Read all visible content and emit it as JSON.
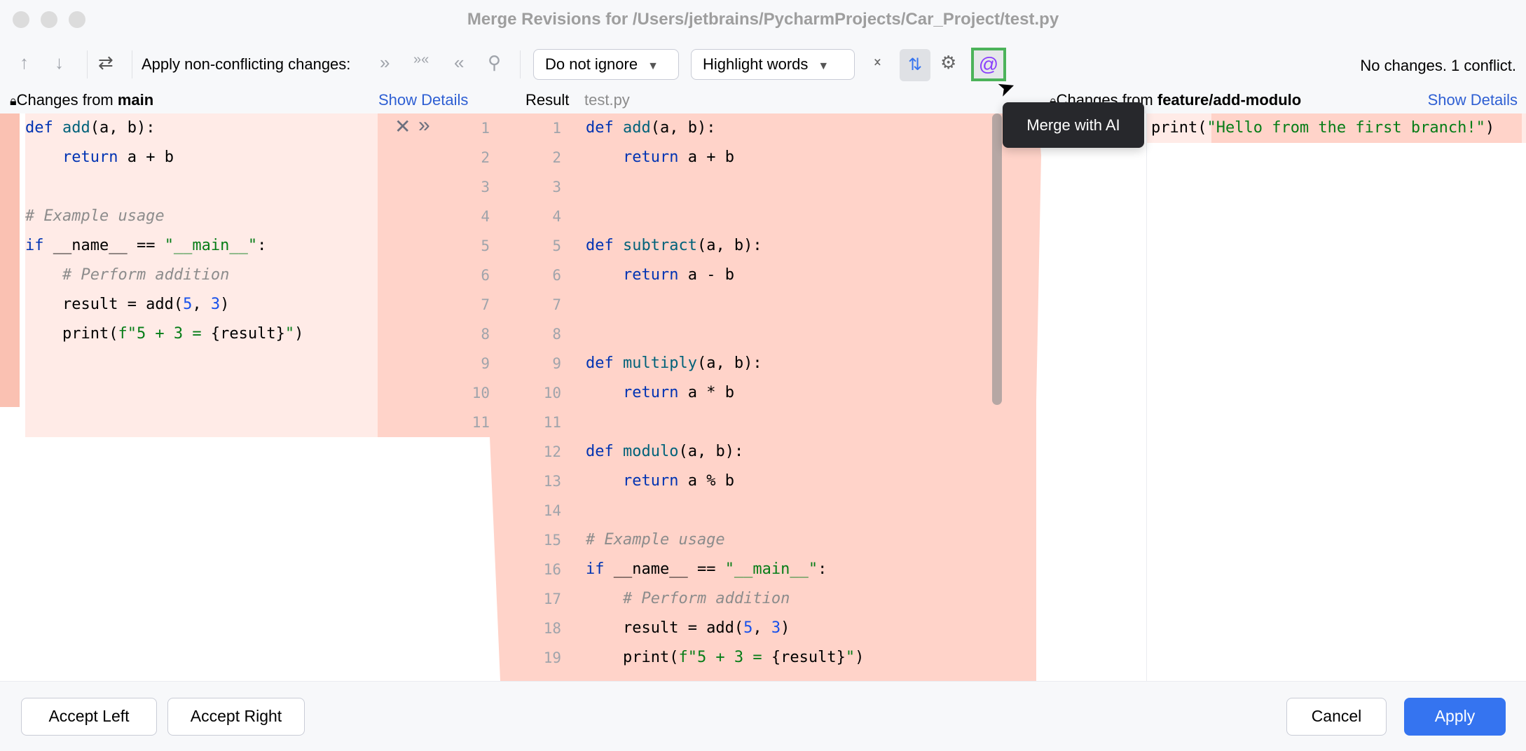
{
  "window": {
    "title": "Merge Revisions for /Users/jetbrains/PycharmProjects/Car_Project/test.py"
  },
  "toolbar": {
    "prev_label": "↑",
    "next_label": "↓",
    "apply_label": "Apply non-conflicting changes:",
    "ignore_dropdown": "Do not ignore",
    "highlight_dropdown": "Highlight words",
    "status": "No changes. 1 conflict.",
    "tooltip": "Merge with AI",
    "ai_color": "#8a3ffc"
  },
  "left": {
    "prefix": "Changes from ",
    "branch": "main",
    "details": "Show Details"
  },
  "center": {
    "label": "Result",
    "file": "test.py"
  },
  "right": {
    "prefix": "Changes from ",
    "branch": "feature/add-modulo",
    "details": "Show Details"
  },
  "left_lines": [
    [
      [
        "kw",
        "def "
      ],
      [
        "fn",
        "add"
      ],
      [
        "",
        "(a, b):"
      ]
    ],
    [
      [
        "",
        "    "
      ],
      [
        "kw",
        "return"
      ],
      [
        "",
        " a + b"
      ]
    ],
    [],
    [
      [
        "cm",
        "# Example usage"
      ]
    ],
    [
      [
        "kw",
        "if"
      ],
      [
        "",
        " __name__ == "
      ],
      [
        "str",
        "\"__main__\""
      ],
      [
        "",
        ":"
      ]
    ],
    [
      [
        "",
        "    "
      ],
      [
        "cm",
        "# Perform addition"
      ]
    ],
    [
      [
        "",
        "    result = add("
      ],
      [
        "num",
        "5"
      ],
      [
        "",
        ", "
      ],
      [
        "num",
        "3"
      ],
      [
        "",
        ")"
      ]
    ],
    [
      [
        "",
        "    print("
      ],
      [
        "str",
        "f\"5 + 3 = "
      ],
      [
        "",
        "{result}"
      ],
      [
        "str",
        "\""
      ],
      [
        "",
        ")"
      ]
    ],
    [],
    [],
    []
  ],
  "left_numbers": [
    "1",
    "2",
    "3",
    "4",
    "5",
    "6",
    "7",
    "8",
    "9",
    "10",
    "11"
  ],
  "result_numbers": [
    "1",
    "2",
    "3",
    "4",
    "5",
    "6",
    "7",
    "8",
    "9",
    "10",
    "11",
    "12",
    "13",
    "14",
    "15",
    "16",
    "17",
    "18",
    "19"
  ],
  "result_lines": [
    [
      [
        "kw",
        "def "
      ],
      [
        "fn",
        "add"
      ],
      [
        "",
        "(a, b):"
      ]
    ],
    [
      [
        "",
        "    "
      ],
      [
        "kw",
        "return"
      ],
      [
        "",
        " a + b"
      ]
    ],
    [],
    [],
    [
      [
        "kw",
        "def "
      ],
      [
        "fn",
        "subtract"
      ],
      [
        "",
        "(a, b):"
      ]
    ],
    [
      [
        "",
        "    "
      ],
      [
        "kw",
        "return"
      ],
      [
        "",
        " a - b"
      ]
    ],
    [],
    [],
    [
      [
        "kw",
        "def "
      ],
      [
        "fn",
        "multiply"
      ],
      [
        "",
        "(a, b):"
      ]
    ],
    [
      [
        "",
        "    "
      ],
      [
        "kw",
        "return"
      ],
      [
        "",
        " a * b"
      ]
    ],
    [],
    [
      [
        "kw",
        "def "
      ],
      [
        "fn",
        "modulo"
      ],
      [
        "",
        "(a, b):"
      ]
    ],
    [
      [
        "",
        "    "
      ],
      [
        "kw",
        "return"
      ],
      [
        "",
        " a % b"
      ]
    ],
    [],
    [
      [
        "cm",
        "# Example usage"
      ]
    ],
    [
      [
        "kw",
        "if"
      ],
      [
        "",
        " __name__ == "
      ],
      [
        "str",
        "\"__main__\""
      ],
      [
        "",
        ":"
      ]
    ],
    [
      [
        "",
        "    "
      ],
      [
        "cm",
        "# Perform addition"
      ]
    ],
    [
      [
        "",
        "    result = add("
      ],
      [
        "num",
        "5"
      ],
      [
        "",
        ", "
      ],
      [
        "num",
        "3"
      ],
      [
        "",
        ")"
      ]
    ],
    [
      [
        "",
        "    print("
      ],
      [
        "str",
        "f\"5 + 3 = "
      ],
      [
        "",
        "{result}"
      ],
      [
        "str",
        "\""
      ],
      [
        "",
        ")"
      ]
    ]
  ],
  "right_lines": [
    [
      [
        "",
        "print("
      ],
      [
        "str",
        "\"Hello from the first branch!\""
      ],
      [
        "",
        ")"
      ]
    ]
  ],
  "footer": {
    "accept_left": "Accept Left",
    "accept_right": "Accept Right",
    "cancel": "Cancel",
    "apply": "Apply"
  }
}
